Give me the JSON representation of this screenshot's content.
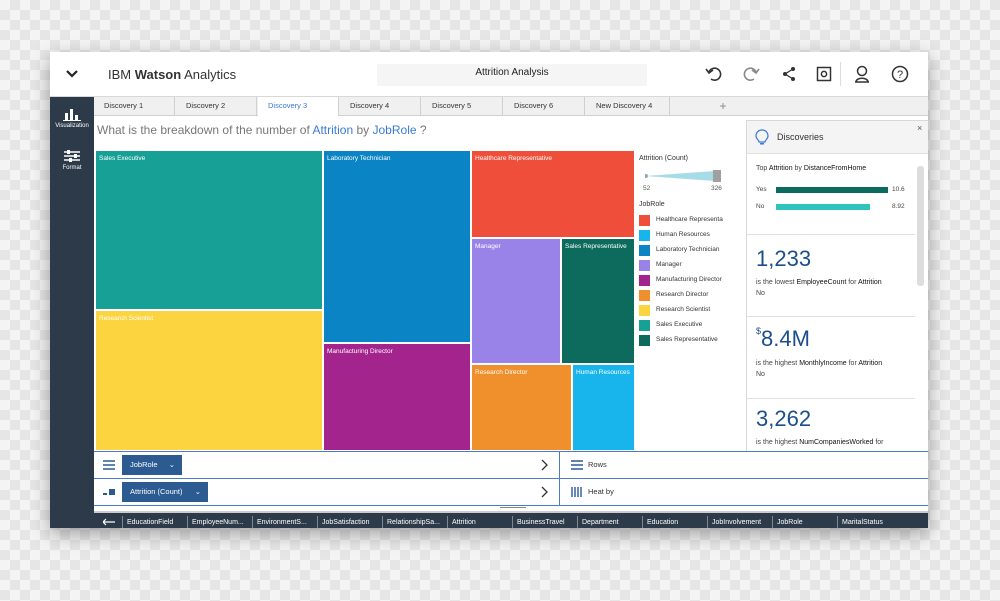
{
  "header": {
    "brand_prefix": "IBM ",
    "brand_bold": "Watson",
    "brand_suffix": " Analytics",
    "project_title": "Attrition Analysis",
    "icons": [
      "chevron-down-icon",
      "undo-icon",
      "redo-icon",
      "share-icon",
      "save-icon",
      "user-icon",
      "help-icon"
    ]
  },
  "sidebar": {
    "items": [
      {
        "label": "Visualization",
        "icon": "bar-chart-icon"
      },
      {
        "label": "Format",
        "icon": "sliders-icon"
      }
    ]
  },
  "tabs": [
    {
      "label": "Discovery 1",
      "active": false
    },
    {
      "label": "Discovery 2",
      "active": false
    },
    {
      "label": "Discovery 3",
      "active": true
    },
    {
      "label": "Discovery 4",
      "active": false
    },
    {
      "label": "Discovery 5",
      "active": false
    },
    {
      "label": "Discovery 6",
      "active": false
    },
    {
      "label": "New Discovery 4",
      "active": false
    }
  ],
  "tab_add": "+",
  "question": {
    "prefix": "What is the breakdown of the number of ",
    "measure": "Attrition",
    "by": " by ",
    "dimension": "JobRole",
    "suffix": " ?"
  },
  "chart_data": {
    "type": "treemap",
    "measure": "Attrition (Count)",
    "dimension": "JobRole",
    "size_range": [
      52,
      326
    ],
    "items": [
      {
        "label": "Sales Executive",
        "color": "#16a096"
      },
      {
        "label": "Research Scientist",
        "color": "#fcd43f"
      },
      {
        "label": "Laboratory Technician",
        "color": "#0a84c4"
      },
      {
        "label": "Manufacturing Director",
        "color": "#a3248c"
      },
      {
        "label": "Healthcare Representative",
        "color": "#ef4f3a"
      },
      {
        "label": "Manager",
        "color": "#9a83e8"
      },
      {
        "label": "Sales Representative",
        "color": "#0c6b5d"
      },
      {
        "label": "Research Director",
        "color": "#f0902c"
      },
      {
        "label": "Human Resources",
        "color": "#18b5ec"
      }
    ]
  },
  "legend": {
    "size_title": "Attrition (Count)",
    "size_min": "52",
    "size_max": "326",
    "color_title": "JobRole",
    "items": [
      {
        "label": "Healthcare Representa",
        "color": "#ef4f3a"
      },
      {
        "label": "Human Resources",
        "color": "#18b5ec"
      },
      {
        "label": "Laboratory Technician",
        "color": "#0a84c4"
      },
      {
        "label": "Manager",
        "color": "#9a83e8"
      },
      {
        "label": "Manufacturing Director",
        "color": "#a3248c"
      },
      {
        "label": "Research Director",
        "color": "#f0902c"
      },
      {
        "label": "Research Scientist",
        "color": "#fcd43f"
      },
      {
        "label": "Sales Executive",
        "color": "#16a096"
      },
      {
        "label": "Sales Representative",
        "color": "#0c6b5d"
      }
    ]
  },
  "discoveries": {
    "title": "Discoveries",
    "close": "×",
    "top_card": {
      "text_prefix": "Top ",
      "text_measure": "Attrition",
      "text_by": " by ",
      "text_dimension": "DistanceFromHome",
      "bars": [
        {
          "label": "Yes",
          "value": "10.6",
          "num": 10.6,
          "color": "#0c6b5d"
        },
        {
          "label": "No",
          "value": "8.92",
          "num": 8.92,
          "color": "#2fc4bb"
        }
      ]
    },
    "cards": [
      {
        "big": "1,233",
        "sup": "",
        "line_prefix": "is the lowest ",
        "line_bold": "EmployeeCount",
        "line_mid": " for ",
        "line_bold2": "Attrition",
        "line2": "No"
      },
      {
        "big": "8.4M",
        "sup": "$",
        "line_prefix": "is the highest ",
        "line_bold": "MonthlyIncome",
        "line_mid": " for ",
        "line_bold2": "Attrition",
        "line2": "No"
      },
      {
        "big": "3,262",
        "sup": "",
        "line_prefix": "is the highest ",
        "line_bold": "NumCompaniesWorked",
        "line_mid": " for",
        "line_bold2": "",
        "line2": ""
      }
    ]
  },
  "shelves": [
    {
      "pill": "JobRole",
      "target": "Rows"
    },
    {
      "pill": "Attrition (Count)",
      "target": "Heat by"
    }
  ],
  "fields": [
    "EducationField",
    "EmployeeNum...",
    "EnvironmentS...",
    "JobSatisfaction",
    "RelationshipSa...",
    "Attrition",
    "BusinessTravel",
    "Department",
    "Education",
    "JobInvolvement",
    "JobRole",
    "MaritalStatus"
  ]
}
